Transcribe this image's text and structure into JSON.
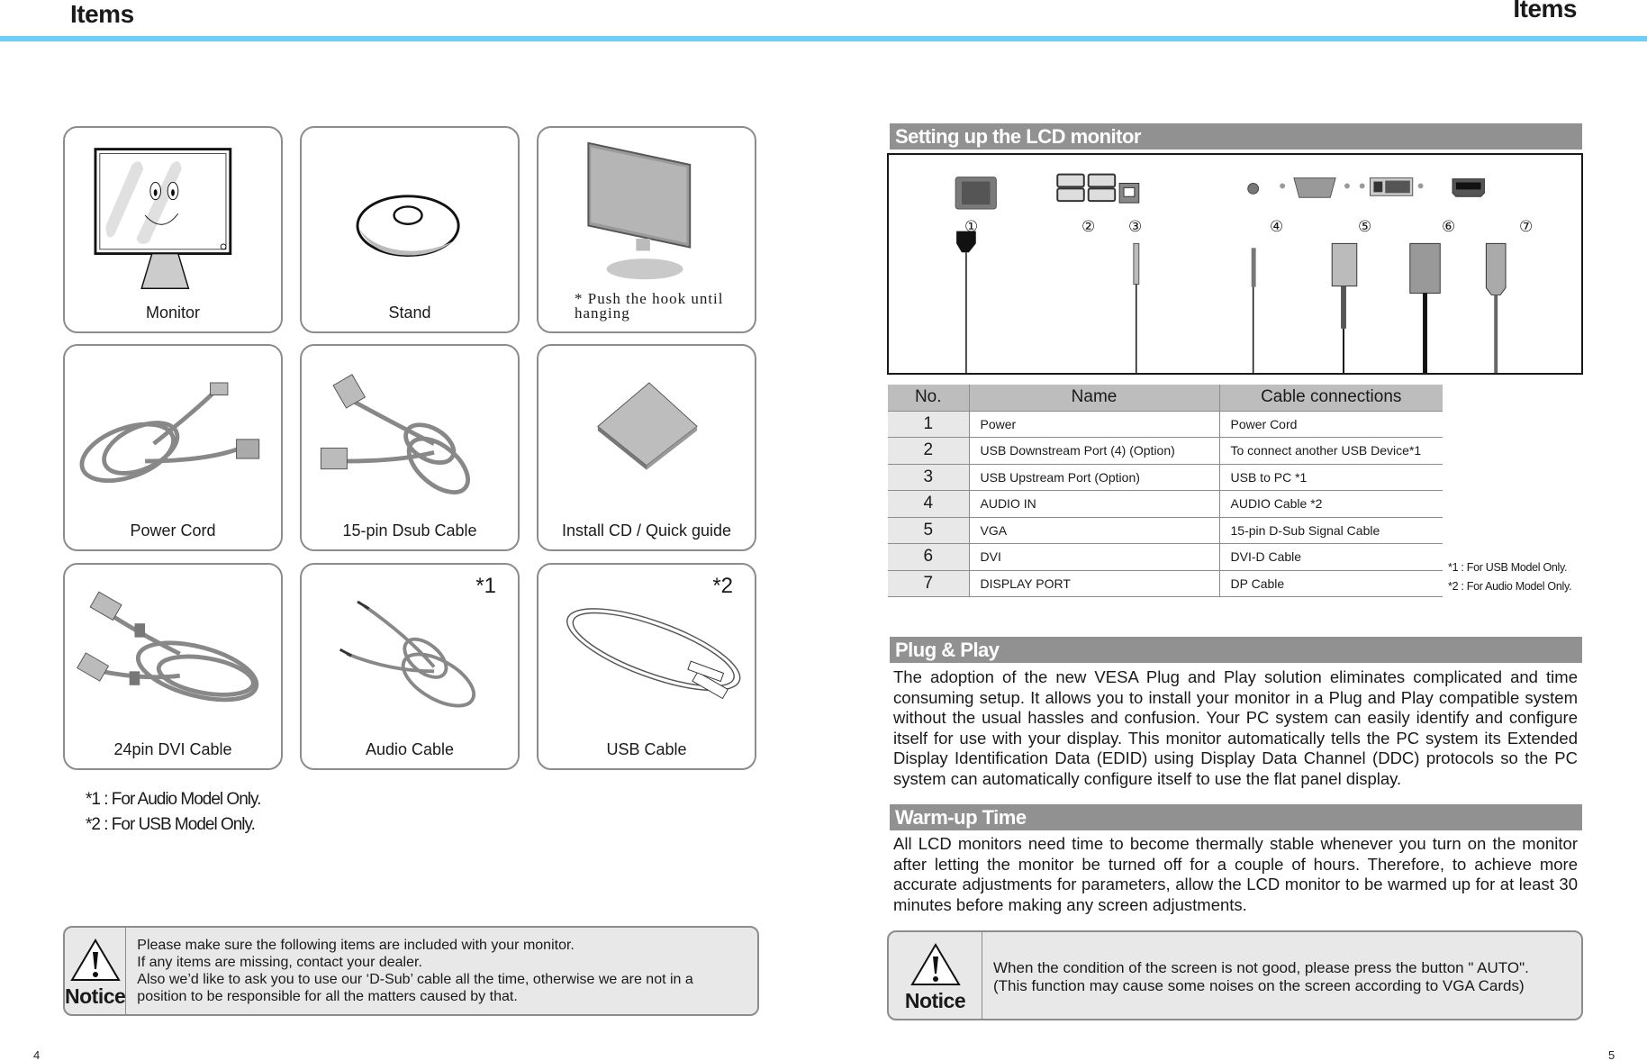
{
  "header": {
    "left_title": "Items",
    "right_title": "Items",
    "accent_color": "#6dcff6"
  },
  "page_numbers": {
    "left": "4",
    "right": "5"
  },
  "items": [
    {
      "label": "Monitor",
      "icon": "monitor-icon"
    },
    {
      "label": "Stand",
      "icon": "stand-icon"
    },
    {
      "label": "",
      "icon": "monitor-on-stand-icon",
      "note": "* Push the hook until hanging"
    },
    {
      "label": "Power Cord",
      "icon": "power-cord-icon"
    },
    {
      "label": "15-pin Dsub Cable",
      "icon": "dsub-cable-icon"
    },
    {
      "label": "Install CD / Quick guide",
      "icon": "quick-guide-icon"
    },
    {
      "label": "24pin DVI Cable",
      "icon": "dvi-cable-icon"
    },
    {
      "label": "Audio Cable",
      "icon": "audio-cable-icon",
      "mark": "*1"
    },
    {
      "label": "USB Cable",
      "icon": "usb-cable-icon",
      "mark": "*2"
    }
  ],
  "items_footnotes": [
    "*1 : For Audio Model Only.",
    "*2 : For USB  Model Only."
  ],
  "notice_left": {
    "word": "Notice",
    "lines": [
      "Please make sure the following items are included with your monitor.",
      "If any items are missing, contact your dealer.",
      "Also we’d like to ask you to use our ‘D-Sub’ cable all the time, otherwise we are not in a position to be responsible for all the matters caused by that."
    ]
  },
  "setup": {
    "title": "Setting up the LCD monitor",
    "port_numbers": [
      "①",
      "②",
      "③",
      "④",
      "⑤",
      "⑥",
      "⑦"
    ],
    "table": {
      "headers": [
        "No.",
        "Name",
        "Cable connections"
      ],
      "rows": [
        {
          "no": "1",
          "name": "Power",
          "cable": "Power Cord"
        },
        {
          "no": "2",
          "name": "USB Downstream Port (4) (Option)",
          "cable": "To connect another USB Device*1"
        },
        {
          "no": "3",
          "name": "USB Upstream Port (Option)",
          "cable": "USB to PC *1"
        },
        {
          "no": "4",
          "name": "AUDIO IN",
          "cable": "AUDIO Cable *2"
        },
        {
          "no": "5",
          "name": "VGA",
          "cable": "15-pin D-Sub Signal Cable"
        },
        {
          "no": "6",
          "name": "DVI",
          "cable": "DVI-D Cable"
        },
        {
          "no": "7",
          "name": "DISPLAY PORT",
          "cable": "DP Cable"
        }
      ]
    },
    "notes": [
      "*1 : For USB Model Only.",
      "*2 : For Audio Model Only."
    ]
  },
  "plug_and_play": {
    "title": "Plug & Play",
    "text": "The adoption of the new VESA Plug and Play solution eliminates complicated and time consuming setup. It allows you to install your monitor in a Plug and Play compatible system without the usual hassles and confusion. Your PC system can easily identify and configure itself for use with your display. This monitor automatically tells the PC system its Extended Display Identification Data (EDID) using Display Data Channel (DDC) protocols so the PC system can automatically configure itself to use the flat panel display."
  },
  "warm_up": {
    "title": "Warm-up Time",
    "text": " All LCD monitors need time to become thermally stable whenever you turn on the monitor after letting the monitor be turned off for a couple of hours. Therefore, to achieve more accurate adjustments for parameters, allow the LCD monitor to be warmed up for at least 30 minutes before making any screen adjustments."
  },
  "notice_right": {
    "word": "Notice",
    "lines": [
      "When the condition of the screen is not good, please press the button \" AUTO\".",
      "(This function may cause some noises on the screen according to VGA Cards)"
    ]
  }
}
